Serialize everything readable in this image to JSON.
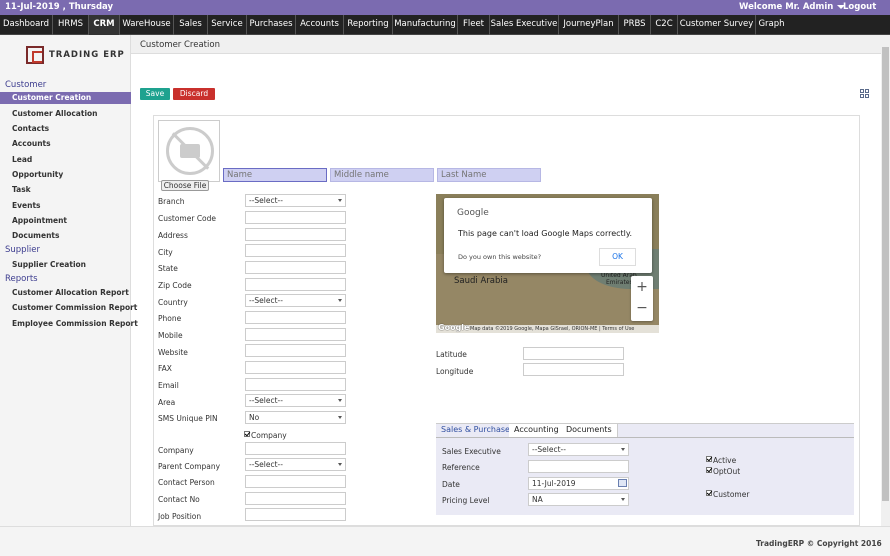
{
  "topbar": {
    "date": "11-Jul-2019 , Thursday",
    "welcome": "Welcome Mr. Admin",
    "logout": "Logout"
  },
  "nav": [
    "Dashboard",
    "HRMS",
    "CRM",
    "WareHouse",
    "Sales",
    "Service",
    "Purchases",
    "Accounts",
    "Reporting",
    "Manufacturing",
    "Fleet",
    "Sales Executive",
    "JourneyPlan",
    "PRBS",
    "C2C",
    "Customer Survey",
    "Graph"
  ],
  "nav_active": "CRM",
  "logo": "TRADING ERP",
  "sidebar": {
    "customer_head": "Customer",
    "customer_items": [
      "Customer Creation",
      "Customer Allocation",
      "Contacts",
      "Accounts",
      "Lead",
      "Opportunity",
      "Task",
      "Events",
      "Appointment",
      "Documents"
    ],
    "supplier_head": "Supplier",
    "supplier_items": [
      "Supplier Creation"
    ],
    "reports_head": "Reports",
    "reports_items": [
      "Customer Allocation Report",
      "Customer Commission Report",
      "Employee Commission Report"
    ]
  },
  "page_title": "Customer Creation",
  "buttons": {
    "save": "Save",
    "discard": "Discard"
  },
  "photo": {
    "choose_file": "Choose File"
  },
  "name": {
    "first_placeholder": "Name",
    "middle_placeholder": "Middle name",
    "last_placeholder": "Last Name"
  },
  "form": {
    "branch": {
      "label": "Branch",
      "value": "--Select--"
    },
    "customer_code": {
      "label": "Customer Code",
      "value": ""
    },
    "address": {
      "label": "Address",
      "value": ""
    },
    "city": {
      "label": "City",
      "value": ""
    },
    "state": {
      "label": "State",
      "value": ""
    },
    "zip_code": {
      "label": "Zip Code",
      "value": ""
    },
    "country": {
      "label": "Country",
      "value": "--Select--"
    },
    "phone": {
      "label": "Phone",
      "value": ""
    },
    "mobile": {
      "label": "Mobile",
      "value": ""
    },
    "website": {
      "label": "Website",
      "value": ""
    },
    "fax": {
      "label": "FAX",
      "value": ""
    },
    "email": {
      "label": "Email",
      "value": ""
    },
    "area": {
      "label": "Area",
      "value": "--Select--"
    },
    "sms_pin": {
      "label": "SMS Unique PIN",
      "value": "No"
    },
    "company_checkbox": {
      "label": "Company",
      "checked": true
    },
    "company": {
      "label": "Company",
      "value": ""
    },
    "parent_company": {
      "label": "Parent Company",
      "value": "--Select--"
    },
    "contact_person": {
      "label": "Contact Person",
      "value": ""
    },
    "contact_no": {
      "label": "Contact No",
      "value": ""
    },
    "job_position": {
      "label": "Job Position",
      "value": ""
    }
  },
  "map": {
    "brand": "Google",
    "message": "This page can't load Google Maps correctly.",
    "question": "Do you own this website?",
    "ok": "OK",
    "place_saudi": "Saudi Arabia",
    "place_uae_1": "United Arab",
    "place_uae_2": "Emirates",
    "zoom_in": "+",
    "zoom_out": "−",
    "footer": "Map data ©2019 Google, Mapa GISrael, ORION-ME | Terms of Use",
    "google_logo": "Google"
  },
  "location": {
    "latitude": {
      "label": "Latitude",
      "value": ""
    },
    "longitude": {
      "label": "Longitude",
      "value": ""
    }
  },
  "tabs": [
    "Sales & Purchase",
    "Accounting",
    "Documents"
  ],
  "sales": {
    "sales_executive": {
      "label": "Sales Executive",
      "value": "--Select--"
    },
    "reference": {
      "label": "Reference",
      "value": ""
    },
    "date": {
      "label": "Date",
      "value": "11-Jul-2019"
    },
    "pricing_level": {
      "label": "Pricing Level",
      "value": "NA"
    },
    "active": {
      "label": "Active",
      "checked": true
    },
    "optout": {
      "label": "OptOut",
      "checked": true
    },
    "customer": {
      "label": "Customer",
      "checked": true
    }
  },
  "footer": "TradingERP © Copyright 2016"
}
